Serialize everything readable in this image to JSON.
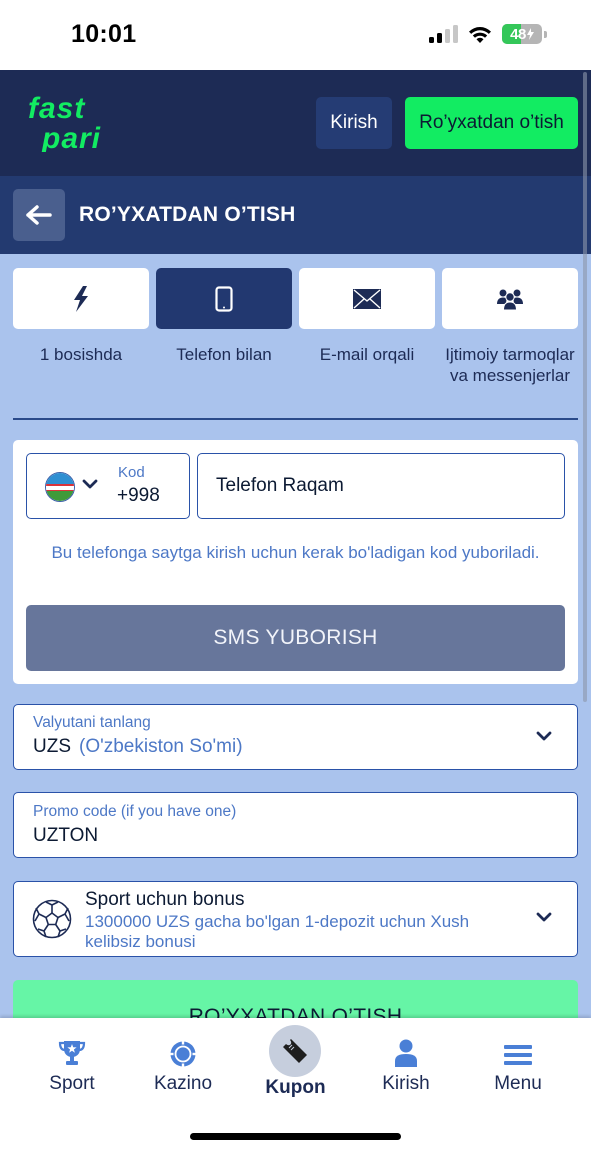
{
  "status_bar": {
    "time": "10:01",
    "battery_percent": "48",
    "battery_level": 0.48,
    "signal_bars_active": 2,
    "signal_bars_total": 4,
    "icons": [
      "signal-icon",
      "wifi-icon",
      "battery-charging-icon"
    ]
  },
  "header": {
    "logo_line1": "fast",
    "logo_line2": "pari",
    "login_label": "Kirish",
    "register_label": "Ro’yxatdan o’tish"
  },
  "title_bar": {
    "back_icon": "arrow-left-icon",
    "title": "RO’YXATDAN O’TISH"
  },
  "registration_tabs": [
    {
      "label": "1 bosishda",
      "icon": "lightning-icon",
      "active": false
    },
    {
      "label": "Telefon bilan",
      "icon": "tablet-icon",
      "active": true
    },
    {
      "label": "E-mail orqali",
      "icon": "envelope-icon",
      "active": false
    },
    {
      "label": "Ijtimoiy tarmoqlar va messenjerlar",
      "icon": "users-icon",
      "active": false
    }
  ],
  "phone_form": {
    "country_flag": "uzbekistan-flag",
    "code_label": "Kod",
    "code_value": "+998",
    "phone_placeholder": "Telefon Raqam",
    "hint": "Bu telefonga saytga kirish uchun kerak bo'ladigan kod yuboriladi.",
    "sms_button": "SMS YUBORISH"
  },
  "currency": {
    "label": "Valyutani tanlang",
    "code": "UZS",
    "name": "(O'zbekiston So'mi)"
  },
  "promo": {
    "label": "Promo code (if you have one)",
    "value": "UZTON"
  },
  "bonus": {
    "icon": "soccer-ball-icon",
    "title": "Sport uchun bonus",
    "description": "1300000 UZS gacha bo'lgan 1-depozit uchun Xush kelibsiz bonusi"
  },
  "submit_label": "RO’YXATDAN O’TISH",
  "bottom_nav": {
    "items": [
      {
        "label": "Sport",
        "icon": "trophy-icon"
      },
      {
        "label": "Kazino",
        "icon": "casino-chip-icon"
      },
      {
        "label": "Kupon",
        "icon": "ticket-icon",
        "active": true
      },
      {
        "label": "Kirish",
        "icon": "user-icon"
      },
      {
        "label": "Menu",
        "icon": "hamburger-menu-icon"
      }
    ]
  },
  "colors": {
    "header_bg": "#1d2b55",
    "title_bar_bg": "#233a70",
    "page_bg": "#aac3ed",
    "brand_green": "#12ec62",
    "submit_green": "#66f5a6",
    "accent_blue": "#4d78c6",
    "sms_button_bg": "#67769b"
  }
}
